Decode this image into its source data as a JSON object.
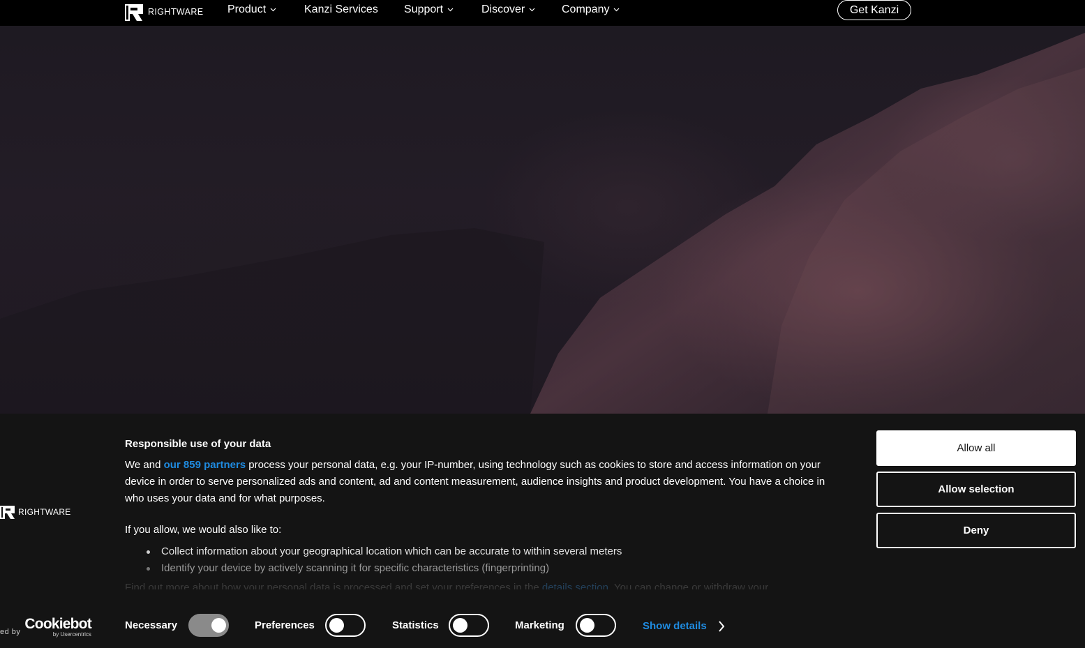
{
  "nav": {
    "brand": "RIGHTWARE",
    "items": [
      {
        "label": "Product",
        "dropdown": true
      },
      {
        "label": "Kanzi Services",
        "dropdown": false
      },
      {
        "label": "Support",
        "dropdown": true
      },
      {
        "label": "Discover",
        "dropdown": true
      },
      {
        "label": "Company",
        "dropdown": true
      }
    ],
    "cta": "Get Kanzi"
  },
  "cookie_banner": {
    "brand": "RIGHTWARE",
    "title": "Responsible use of your data",
    "intro_before_link": "We and ",
    "intro_link": "our 859 partners",
    "intro_after_link": " process your personal data, e.g. your IP-number, using technology such as cookies to store and access information on your device in order to serve personalized ads and content, ad and content measurement, audience insights and product development. You have a choice in who uses your data and for what purposes.",
    "allow_title": "If you allow, we would also like to:",
    "allow_items": [
      "Collect information about your geographical location which can be accurate to within several meters",
      "Identify your device by actively scanning it for specific characteristics (fingerprinting)"
    ],
    "faded_line_before": "Find out more about how your personal data is processed and set your preferences in the ",
    "faded_line_link": "details section",
    "faded_line_after": ". You can change or withdraw your",
    "buttons": {
      "allow_all": "Allow all",
      "allow_selection": "Allow selection",
      "deny": "Deny"
    },
    "powered_by": "ed by",
    "cookiebot_word": "Cookiebot",
    "cookiebot_sub": "by Usercentrics",
    "toggles": [
      {
        "label": "Necessary",
        "on": true
      },
      {
        "label": "Preferences",
        "on": false
      },
      {
        "label": "Statistics",
        "on": false
      },
      {
        "label": "Marketing",
        "on": false
      }
    ],
    "show_details": "Show details"
  }
}
